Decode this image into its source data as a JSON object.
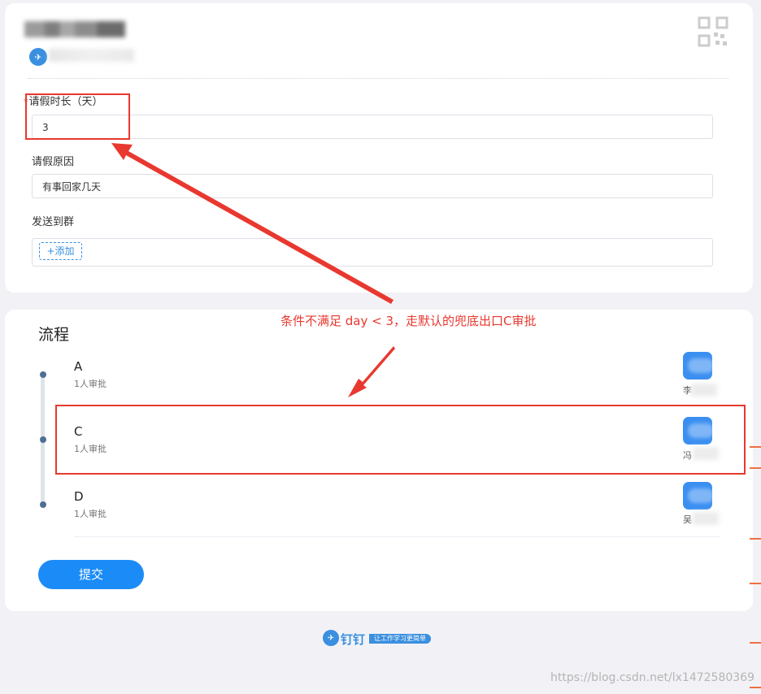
{
  "form": {
    "duration_required_mark": "*",
    "duration_label": "请假时长（天）",
    "duration_value": "3",
    "reason_label": "请假原因",
    "reason_value": "有事回家几天",
    "group_label": "发送到群",
    "add_label": "+添加"
  },
  "annotation": {
    "text": "条件不满足 day < 3，走默认的兜底出口C审批",
    "color": "#e8382f"
  },
  "flow": {
    "title": "流程",
    "steps": [
      {
        "name": "A",
        "count": "1人审批",
        "approver_initial": "李"
      },
      {
        "name": "C",
        "count": "1人审批",
        "approver_initial": "冯"
      },
      {
        "name": "D",
        "count": "1人审批",
        "approver_initial": "吴"
      }
    ]
  },
  "actions": {
    "submit_label": "提交"
  },
  "footer": {
    "brand": "钉钉",
    "slogan": "让工作学习更简单",
    "watermark": "https://blog.csdn.net/lx1472580369"
  },
  "colors": {
    "accent": "#1b8cf7",
    "brand_blue": "#3a8fdf",
    "annotation_red": "#e8382f",
    "background": "#f2f2f6"
  },
  "icons": [
    "dingtalk-logo-icon",
    "qr-code-icon",
    "timeline-dot-icon",
    "avatar-icon"
  ]
}
